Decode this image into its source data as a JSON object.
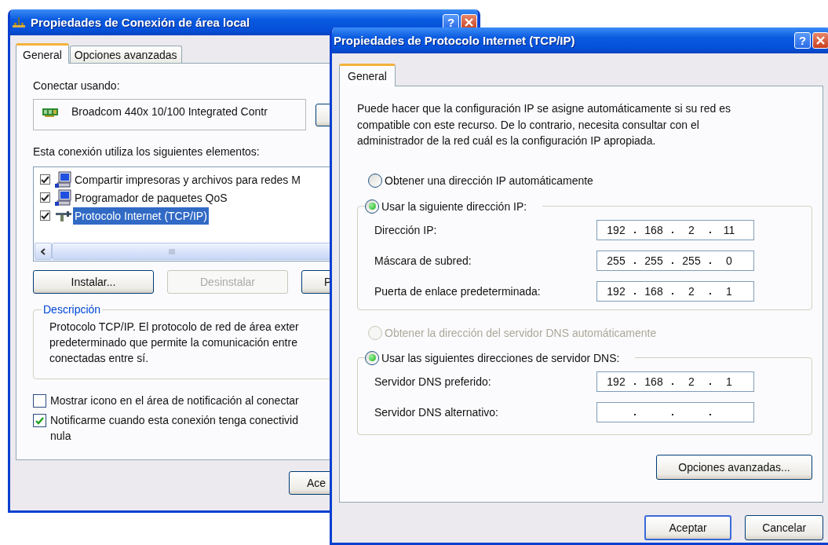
{
  "connection_window": {
    "title": "Propiedades de Conexión de área local",
    "help_button": "?",
    "tabs": [
      {
        "label": "General",
        "selected": true
      },
      {
        "label": "Opciones avanzadas",
        "selected": false
      }
    ],
    "connect_label": "Conectar usando:",
    "adapter": "Broadcom 440x 10/100 Integrated Contr",
    "components_label": "Esta conexión utiliza los siguientes elementos:",
    "components": [
      {
        "kind": "computer",
        "label": "Compartir impresoras y archivos para redes M",
        "checked": true,
        "selected": false
      },
      {
        "kind": "computer",
        "label": "Programador de paquetes QoS",
        "checked": true,
        "selected": false
      },
      {
        "kind": "protocol",
        "label": "Protocolo Internet (TCP/IP)",
        "checked": true,
        "selected": true
      }
    ],
    "buttons": [
      {
        "label": "Instalar...",
        "disabled": false
      },
      {
        "label": "Desinstalar",
        "disabled": true
      },
      {
        "label": "P",
        "disabled": false
      }
    ],
    "description": {
      "title": "Descripción",
      "lines": [
        "Protocolo TCP/IP. El protocolo de red de área exter",
        "predeterminado que permite la comunicación entre",
        "conectadas entre sí."
      ]
    },
    "options": [
      {
        "label": "Mostrar icono en el área de notificación al conectar",
        "checked": false
      },
      {
        "label": "Notificarme cuando esta conexión tenga conectivid\nnula",
        "checked": true
      }
    ],
    "footer_buttons": [
      "Ace"
    ]
  },
  "tcpip_window": {
    "title": "Propiedades de Protocolo Internet (TCP/IP)",
    "help_button": "?",
    "tabs": [
      {
        "label": "General",
        "selected": true
      }
    ],
    "intro": "Puede hacer que la configuración IP se asigne automáticamente si su red es\ncompatible con este recurso. De lo contrario, necesita consultar con el\nadministrador de la red cuál es la configuración IP apropiada.",
    "ip_auto": {
      "label": "Obtener una dirección IP automáticamente",
      "selected": false,
      "disabled": false
    },
    "ip_manual": {
      "label": "Usar la siguiente dirección IP:",
      "selected": true,
      "disabled": false
    },
    "ip_fields": [
      {
        "label": "Dirección IP:",
        "octets": [
          "192",
          "168",
          "2",
          "11"
        ]
      },
      {
        "label": "Máscara de subred:",
        "octets": [
          "255",
          "255",
          "255",
          "0"
        ]
      },
      {
        "label": "Puerta de enlace predeterminada:",
        "octets": [
          "192",
          "168",
          "2",
          "1"
        ]
      }
    ],
    "dns_auto": {
      "label": "Obtener la dirección del servidor DNS automáticamente",
      "selected": false,
      "disabled": true
    },
    "dns_manual": {
      "label": "Usar las siguientes direcciones de servidor DNS:",
      "selected": true,
      "disabled": false
    },
    "dns_fields": [
      {
        "label": "Servidor DNS preferido:",
        "octets": [
          "192",
          "168",
          "2",
          "1"
        ]
      },
      {
        "label": "Servidor DNS alternativo:"
      }
    ],
    "advanced_button": "Opciones avanzadas...",
    "footer_buttons": [
      "Aceptar",
      "Cancelar"
    ]
  }
}
